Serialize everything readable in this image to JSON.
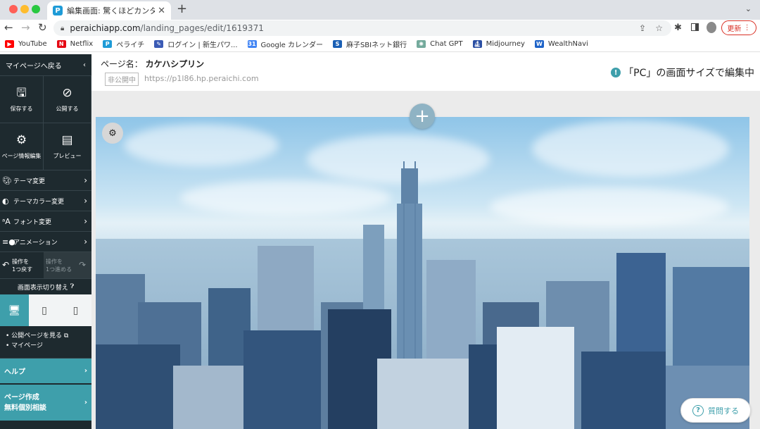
{
  "browser": {
    "tab_title": "編集画面: 驚くほどカンタン！無料",
    "url_host": "peraichiapp.com",
    "url_path": "/landing_pages/edit/1619371",
    "update_label": "更新",
    "bookmarks": [
      {
        "label": "YouTube",
        "color": "#ff0000",
        "icon": "youtube-icon"
      },
      {
        "label": "Netflix",
        "color": "#e50914",
        "icon": "netflix-icon"
      },
      {
        "label": "ペライチ",
        "color": "#1e9bd7",
        "icon": "peraichi-icon"
      },
      {
        "label": "ログイン | 新生パワ...",
        "color": "#3b5bb5",
        "icon": "login-icon"
      },
      {
        "label": "Google カレンダー",
        "color": "#4285f4",
        "icon": "calendar-icon"
      },
      {
        "label": "麻子SBIネット銀行",
        "color": "#1a5fb4",
        "icon": "bank-icon"
      },
      {
        "label": "Chat GPT",
        "color": "#74aa9c",
        "icon": "chatgpt-icon"
      },
      {
        "label": "Midjourney",
        "color": "#2b4fa3",
        "icon": "midjourney-icon"
      },
      {
        "label": "WealthNavi",
        "color": "#1e63c8",
        "icon": "wealthnavi-icon"
      }
    ]
  },
  "sidebar": {
    "back_label": "マイページへ戻る",
    "actions": [
      {
        "label": "保存する",
        "icon": "save-icon"
      },
      {
        "label": "公開する",
        "icon": "publish-icon"
      },
      {
        "label": "ページ情報編集",
        "icon": "gear-icon"
      },
      {
        "label": "プレビュー",
        "icon": "preview-icon"
      }
    ],
    "menu": [
      {
        "label": "テーマ変更",
        "icon": "palette-icon"
      },
      {
        "label": "テーマカラー変更",
        "icon": "color-icon"
      },
      {
        "label": "フォント変更",
        "icon": "font-icon"
      },
      {
        "label": "アニメーション",
        "icon": "animation-icon"
      }
    ],
    "undo_label_1": "操作を",
    "undo_label_2": "1つ戻す",
    "redo_label_1": "操作を",
    "redo_label_2": "1つ進める",
    "switch_title": "画面表示切り替え",
    "links": [
      "公開ページを見る",
      "マイページ"
    ],
    "help_label": "ヘルプ",
    "consult_label_1": "ページ作成",
    "consult_label_2": "無料個別相談"
  },
  "page": {
    "name_label": "ページ名：",
    "name": "カケハシプリン",
    "status": "非公開中",
    "url": "https://p1l86.hp.peraichi.com",
    "mode_text": "「PC」の画面サイズで編集中"
  },
  "ask_label": "質問する"
}
